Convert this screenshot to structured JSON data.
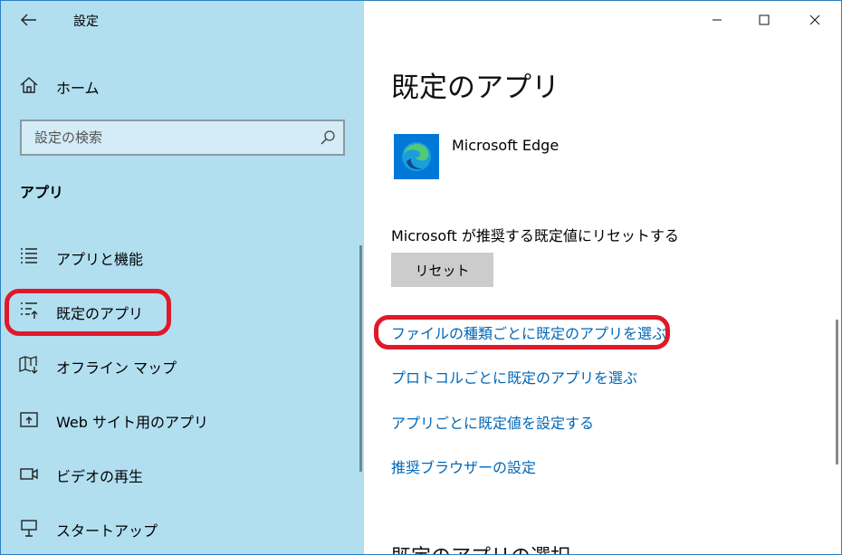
{
  "window": {
    "title": "設定",
    "controls": {
      "minimize": "minimize-icon",
      "maximize": "maximize-icon",
      "close": "close-icon"
    }
  },
  "sidebar": {
    "home_label": "ホーム",
    "search_placeholder": "設定の検索",
    "section_title": "アプリ",
    "items": [
      {
        "label": "アプリと機能",
        "icon": "apps-features-icon"
      },
      {
        "label": "既定のアプリ",
        "icon": "default-apps-icon",
        "selected": true
      },
      {
        "label": "オフライン マップ",
        "icon": "offline-maps-icon"
      },
      {
        "label": "Web サイト用のアプリ",
        "icon": "apps-for-websites-icon"
      },
      {
        "label": "ビデオの再生",
        "icon": "video-playback-icon"
      },
      {
        "label": "スタートアップ",
        "icon": "startup-icon"
      }
    ]
  },
  "main": {
    "title": "既定のアプリ",
    "browser_name": "Microsoft Edge",
    "reset_description": "Microsoft が推奨する既定値にリセットする",
    "reset_button": "リセット",
    "links": [
      "ファイルの種類ごとに既定のアプリを選ぶ",
      "プロトコルごとに既定のアプリを選ぶ",
      "アプリごとに既定値を設定する",
      "推奨ブラウザーの設定"
    ],
    "subsection_title": "既定のアプリの選択"
  },
  "colors": {
    "sidebar_bg": "#b1dff0",
    "link": "#0067b8",
    "highlight_ring": "#e0192a",
    "edge_tile": "#0078d7"
  }
}
